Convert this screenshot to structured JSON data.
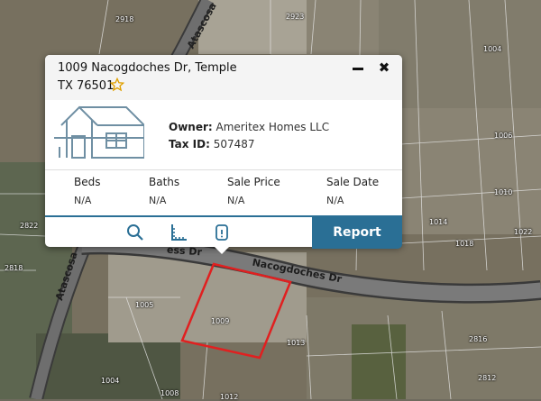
{
  "map": {
    "streets": [
      "Atascosa",
      "Nacogdoches Dr",
      "ess Dr",
      "Atascosa"
    ],
    "lots": [
      "2918",
      "2923",
      "1004",
      "2822",
      "2818",
      "1005",
      "1009",
      "1013",
      "1006",
      "1010",
      "1014",
      "1018",
      "1022",
      "2816",
      "2812",
      "1004",
      "1008",
      "1012"
    ],
    "selected_parcel_color": "#e02020"
  },
  "popup": {
    "address_line1": "1009 Nacogdoches Dr, Temple",
    "address_line2": "TX 76501",
    "favorite_icon": "star-outline-icon",
    "owner_label": "Owner:",
    "owner_value": "Ameritex Homes LLC",
    "tax_label": "Tax ID:",
    "tax_value": "507487",
    "stats": [
      {
        "label": "Beds",
        "value": "N/A"
      },
      {
        "label": "Baths",
        "value": "N/A"
      },
      {
        "label": "Sale Price",
        "value": "N/A"
      },
      {
        "label": "Sale Date",
        "value": "N/A"
      }
    ],
    "tools": [
      "search-icon",
      "ruler-icon",
      "info-icon"
    ],
    "report_label": "Report",
    "accent_color": "#2a6f95"
  }
}
